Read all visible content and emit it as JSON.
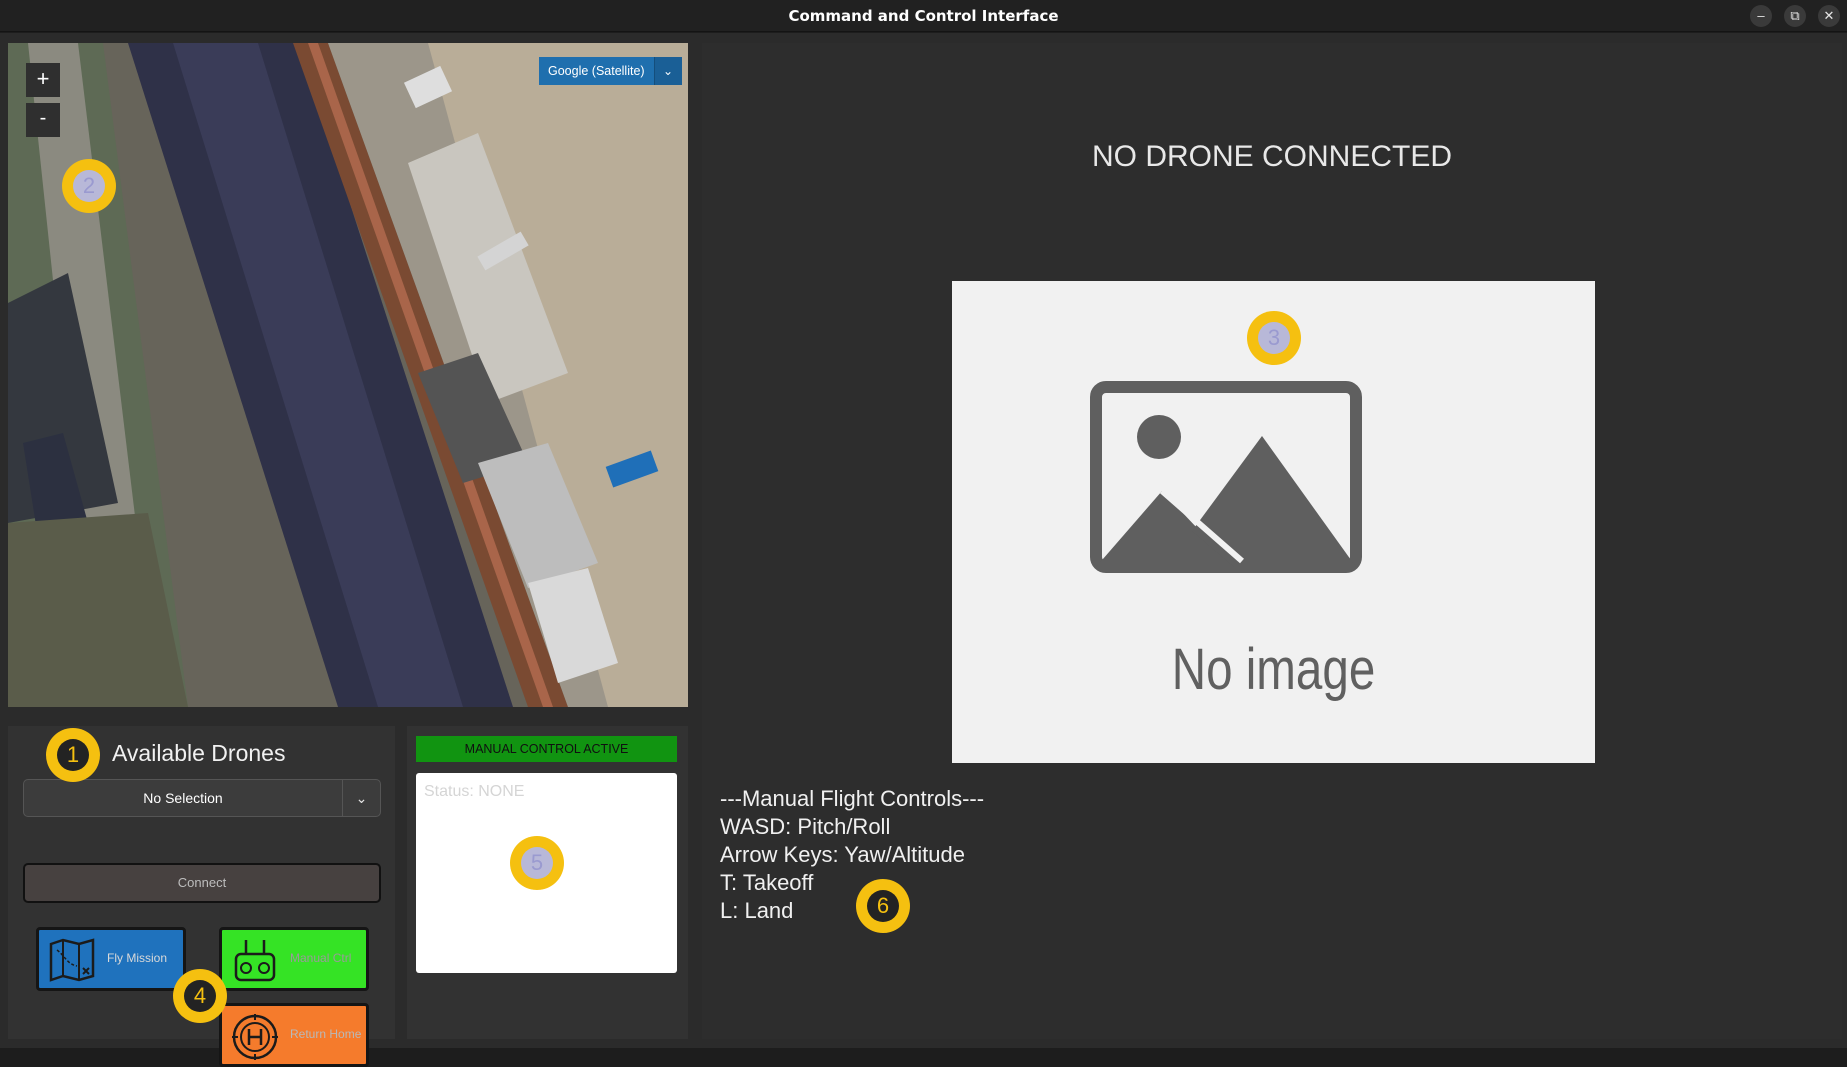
{
  "window": {
    "title": "Command and Control Interface",
    "minimize_icon": "–",
    "restore_icon": "⧉",
    "close_icon": "✕"
  },
  "map": {
    "zoom_in_label": "+",
    "zoom_out_label": "-",
    "source_label": "Google (Satellite)",
    "source_arrow": "⌄"
  },
  "drones": {
    "title": "Available Drones",
    "select_value": "No Selection",
    "select_arrow": "⌄",
    "connect_label": "Connect"
  },
  "actions": {
    "fly_mission_label": "Fly Mission",
    "manual_ctrl_label": "Manual Ctrl",
    "return_home_label": "Return Home"
  },
  "status": {
    "badge_label": "MANUAL CONTROL ACTIVE",
    "status_text": "Status: NONE"
  },
  "video": {
    "heading": "NO DRONE CONNECTED",
    "placeholder_text": "No image"
  },
  "controls": {
    "lines": [
      "---Manual Flight Controls---",
      "WASD: Pitch/Roll",
      "Arrow Keys: Yaw/Altitude",
      "T: Takeoff",
      "L: Land"
    ]
  },
  "callouts": [
    "1",
    "2",
    "3",
    "4",
    "5",
    "6"
  ],
  "colors": {
    "accent_blue": "#1f72bd",
    "manual_green": "#35e325",
    "home_orange": "#f57b2c",
    "badge_green": "#119411",
    "callout_yellow": "#f5c010"
  }
}
